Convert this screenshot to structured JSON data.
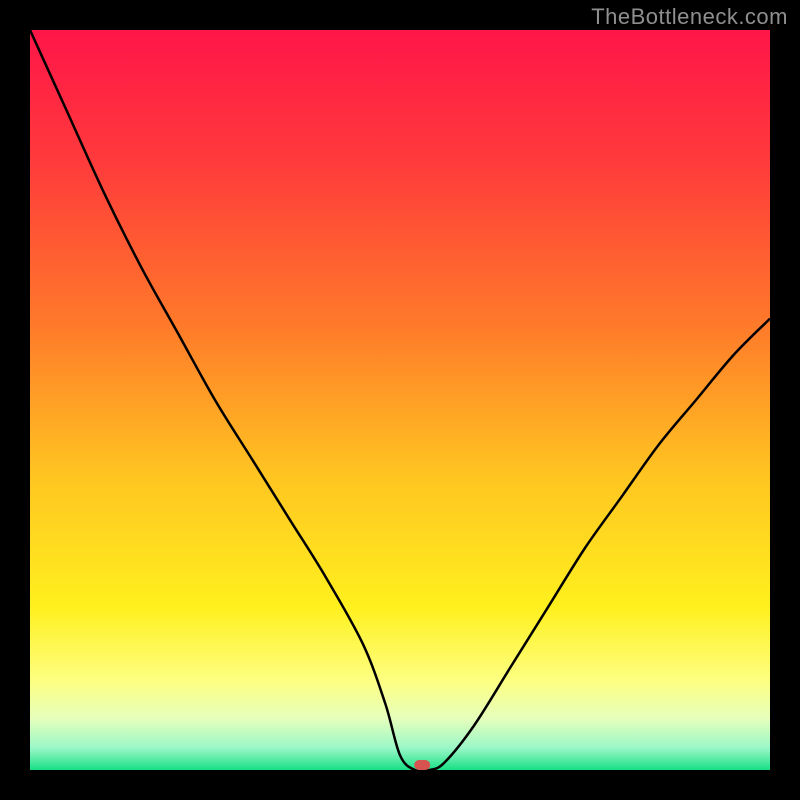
{
  "watermark": "TheBottleneck.com",
  "chart_data": {
    "type": "line",
    "title": "",
    "xlabel": "",
    "ylabel": "",
    "xlim": [
      0,
      1
    ],
    "ylim": [
      0,
      1
    ],
    "x": [
      0.0,
      0.05,
      0.1,
      0.15,
      0.2,
      0.25,
      0.3,
      0.35,
      0.4,
      0.45,
      0.48,
      0.5,
      0.52,
      0.54,
      0.56,
      0.6,
      0.65,
      0.7,
      0.75,
      0.8,
      0.85,
      0.9,
      0.95,
      1.0
    ],
    "values": [
      1.0,
      0.89,
      0.78,
      0.68,
      0.59,
      0.5,
      0.42,
      0.34,
      0.26,
      0.17,
      0.09,
      0.02,
      0.0,
      0.0,
      0.01,
      0.06,
      0.14,
      0.22,
      0.3,
      0.37,
      0.44,
      0.5,
      0.56,
      0.61
    ],
    "marker": {
      "x": 0.53,
      "y": 0.0
    },
    "gradient_stops": [
      {
        "offset": 0.0,
        "color": "#ff1549"
      },
      {
        "offset": 0.18,
        "color": "#ff3b3b"
      },
      {
        "offset": 0.4,
        "color": "#ff7a2a"
      },
      {
        "offset": 0.6,
        "color": "#ffc421"
      },
      {
        "offset": 0.78,
        "color": "#fff01e"
      },
      {
        "offset": 0.88,
        "color": "#fdff82"
      },
      {
        "offset": 0.93,
        "color": "#e6ffbb"
      },
      {
        "offset": 0.97,
        "color": "#9bf7c8"
      },
      {
        "offset": 1.0,
        "color": "#18e085"
      }
    ]
  }
}
